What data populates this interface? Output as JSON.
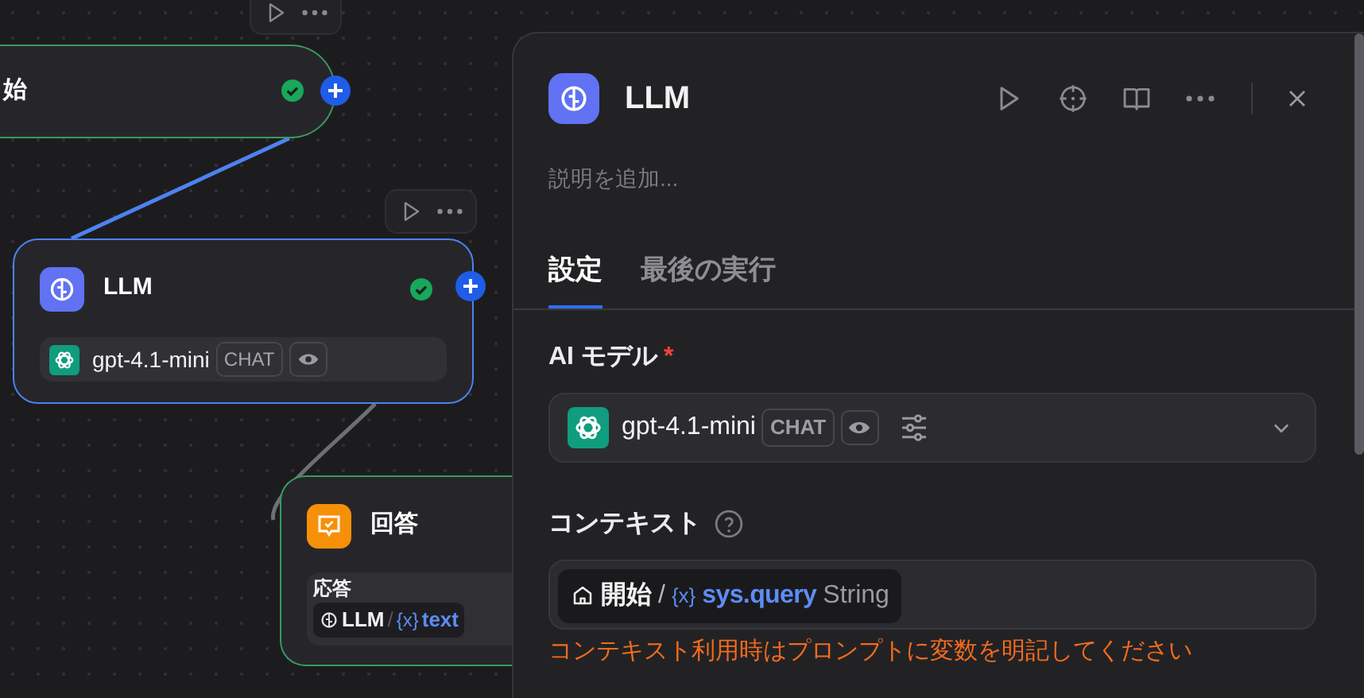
{
  "canvas": {
    "nodes": [
      {
        "kind": "start",
        "title": "始",
        "selected": false,
        "succeeded": true
      },
      {
        "kind": "llm",
        "title": "LLM",
        "selected": true,
        "succeeded": true,
        "model": {
          "name": "gpt-4.1-mini",
          "tag": "CHAT"
        }
      },
      {
        "kind": "answer",
        "title": "回答",
        "selected": false,
        "output": {
          "label": "応答",
          "source": "LLM",
          "separator": "/",
          "variable_mark": "{x}",
          "variable": "text"
        }
      }
    ]
  },
  "panel": {
    "title": "LLM",
    "description": {
      "placeholder": "説明を追加..."
    },
    "tabs": [
      {
        "label": "設定",
        "selected": true
      },
      {
        "label": "最後の実行",
        "selected": false
      }
    ],
    "model_field": {
      "label": "AI モデル",
      "required_mark": "*",
      "model": "gpt-4.1-mini",
      "tag": "CHAT"
    },
    "context_field": {
      "label": "コンテキスト",
      "node": "開始",
      "separator": "/",
      "variable_mark": "{x}",
      "variable": "sys.query",
      "type": "String",
      "warning": "コンテキスト利用時はプロンプトに変数を明記してください"
    }
  }
}
